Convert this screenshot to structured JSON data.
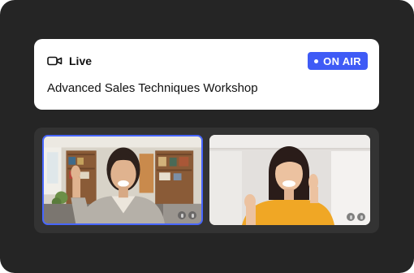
{
  "header": {
    "live_label": "Live",
    "status_badge": "ON AIR",
    "session_title": "Advanced Sales Techniques Workshop",
    "icons": {
      "camera": "video-camera-icon"
    }
  },
  "participants": [
    {
      "name": "",
      "active_speaker": true,
      "controls": [
        "mic-icon",
        "more-icon"
      ]
    },
    {
      "name": "",
      "active_speaker": false,
      "controls": [
        "mic-icon",
        "more-icon"
      ]
    }
  ],
  "colors": {
    "frame_bg": "#252525",
    "card_bg": "#ffffff",
    "badge_bg": "#3f5bf6",
    "active_border": "#4766ff",
    "panel_bg": "#333333"
  }
}
